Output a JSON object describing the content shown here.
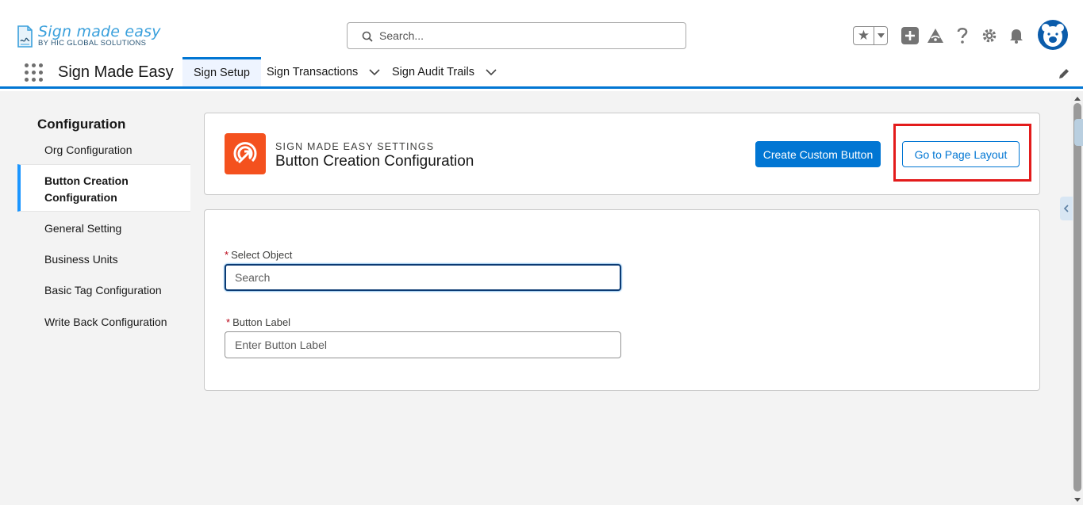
{
  "header": {
    "logo": {
      "brand": "Sign made easy",
      "byline": "BY HIC GLOBAL SOLUTIONS"
    },
    "search": {
      "placeholder": "Search..."
    },
    "icons": [
      "favorites-star-icon",
      "favorites-dropdown-icon",
      "global-actions-plus-icon",
      "trailhead-icon",
      "help-icon",
      "setup-gear-icon",
      "notifications-bell-icon",
      "user-avatar"
    ]
  },
  "nav": {
    "app_name": "Sign Made Easy",
    "tabs": [
      {
        "label": "Sign Setup",
        "active": true,
        "has_menu": false
      },
      {
        "label": "Sign Transactions",
        "active": false,
        "has_menu": true
      },
      {
        "label": "Sign Audit Trails",
        "active": false,
        "has_menu": true
      }
    ]
  },
  "sidebar": {
    "title": "Configuration",
    "items": [
      {
        "label": "Org Configuration",
        "active": false
      },
      {
        "label": "Button Creation Configuration",
        "active": true
      },
      {
        "label": "General Setting",
        "active": false
      },
      {
        "label": "Business Units",
        "active": false
      },
      {
        "label": "Basic Tag Configuration",
        "active": false
      },
      {
        "label": "Write Back Configuration",
        "active": false
      }
    ]
  },
  "page_header": {
    "eyebrow": "SIGN MADE EASY SETTINGS",
    "title": "Button Creation Configuration",
    "primary_button": "Create Custom Button",
    "secondary_button": "Go to Page Layout"
  },
  "form": {
    "select_object": {
      "label": "Select Object",
      "required": true,
      "placeholder": "Search",
      "value": ""
    },
    "button_label": {
      "label": "Button Label",
      "required": true,
      "placeholder": "Enter Button Label",
      "value": ""
    }
  },
  "colors": {
    "brand": "#0176d3",
    "header_icon_bg": "#f4511e",
    "highlight": "#e31b1b",
    "required": "#ba0517"
  }
}
